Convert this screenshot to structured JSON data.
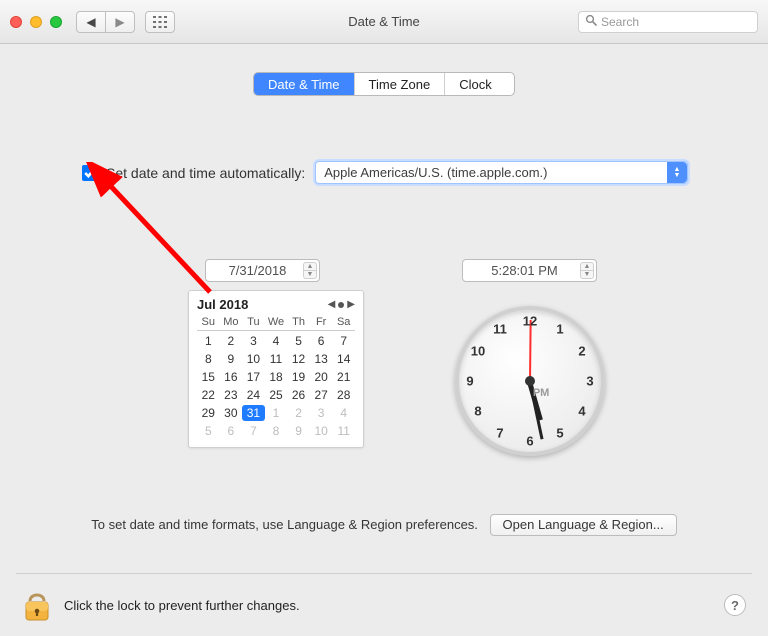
{
  "window": {
    "title": "Date & Time"
  },
  "toolbar": {
    "back_aria": "Back",
    "forward_aria": "Forward",
    "grid_aria": "Show All",
    "search_placeholder": "Search"
  },
  "tabs": {
    "date_time": "Date & Time",
    "time_zone": "Time Zone",
    "clock": "Clock"
  },
  "auto": {
    "checked": true,
    "label": "Set date and time automatically:",
    "server": "Apple Americas/U.S. (time.apple.com.)"
  },
  "date": {
    "field_value": "7/31/2018"
  },
  "time": {
    "field_value": "5:28:01 PM",
    "ampm_face": "PM",
    "hour_angle_deg": 74,
    "minute_angle_deg": 78,
    "second_angle_deg": -89.4
  },
  "calendar": {
    "title": "Jul 2018",
    "dow": [
      "Su",
      "Mo",
      "Tu",
      "We",
      "Th",
      "Fr",
      "Sa"
    ],
    "rows": [
      [
        {
          "n": 1
        },
        {
          "n": 2
        },
        {
          "n": 3
        },
        {
          "n": 4
        },
        {
          "n": 5
        },
        {
          "n": 6
        },
        {
          "n": 7
        }
      ],
      [
        {
          "n": 8
        },
        {
          "n": 9
        },
        {
          "n": 10
        },
        {
          "n": 11
        },
        {
          "n": 12
        },
        {
          "n": 13
        },
        {
          "n": 14
        }
      ],
      [
        {
          "n": 15
        },
        {
          "n": 16
        },
        {
          "n": 17
        },
        {
          "n": 18
        },
        {
          "n": 19
        },
        {
          "n": 20
        },
        {
          "n": 21
        }
      ],
      [
        {
          "n": 22
        },
        {
          "n": 23
        },
        {
          "n": 24
        },
        {
          "n": 25
        },
        {
          "n": 26
        },
        {
          "n": 27
        },
        {
          "n": 28
        }
      ],
      [
        {
          "n": 29
        },
        {
          "n": 30
        },
        {
          "n": 31,
          "sel": true
        },
        {
          "n": 1,
          "gray": true
        },
        {
          "n": 2,
          "gray": true
        },
        {
          "n": 3,
          "gray": true
        },
        {
          "n": 4,
          "gray": true
        }
      ],
      [
        {
          "n": 5,
          "gray": true
        },
        {
          "n": 6,
          "gray": true
        },
        {
          "n": 7,
          "gray": true
        },
        {
          "n": 8,
          "gray": true
        },
        {
          "n": 9,
          "gray": true
        },
        {
          "n": 10,
          "gray": true
        },
        {
          "n": 11,
          "gray": true
        }
      ]
    ]
  },
  "footer": {
    "note": "To set date and time formats, use Language & Region preferences.",
    "open_button": "Open Language & Region..."
  },
  "lock": {
    "text": "Click the lock to prevent further changes."
  },
  "help": {
    "label": "?"
  }
}
